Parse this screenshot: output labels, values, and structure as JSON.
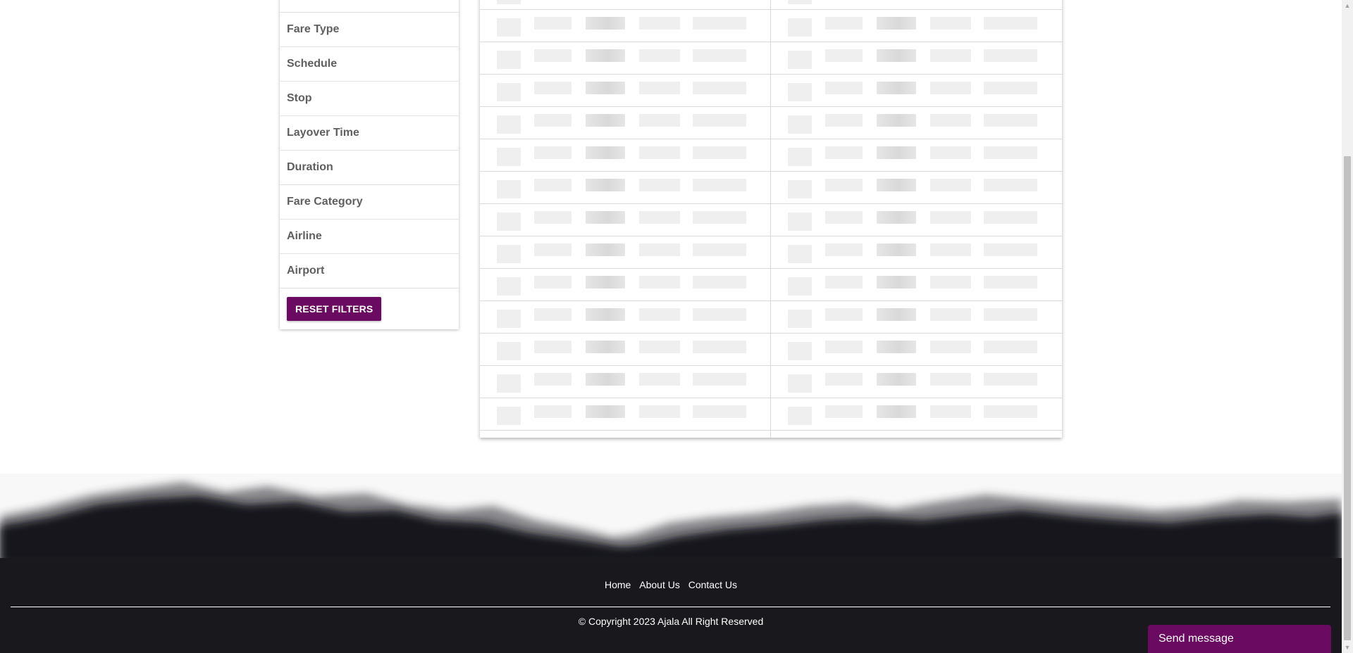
{
  "filters": {
    "items": [
      {
        "label": "Fare Type"
      },
      {
        "label": "Schedule"
      },
      {
        "label": "Stop"
      },
      {
        "label": "Layover Time"
      },
      {
        "label": "Duration"
      },
      {
        "label": "Fare Category"
      },
      {
        "label": "Airline"
      },
      {
        "label": "Airport"
      }
    ],
    "reset_label": "RESET FILTERS"
  },
  "footer": {
    "links": [
      "Home",
      "About Us",
      "Contact Us"
    ],
    "copyright": "© Copyright 2023 Ajala All Right Reserved"
  },
  "chat": {
    "label": "Send message"
  },
  "colors": {
    "brand": "#6a0a61",
    "footer": "#18181d"
  },
  "icons": {
    "scroll_up": "triangle-up-icon",
    "scroll_down": "triangle-down-icon"
  }
}
